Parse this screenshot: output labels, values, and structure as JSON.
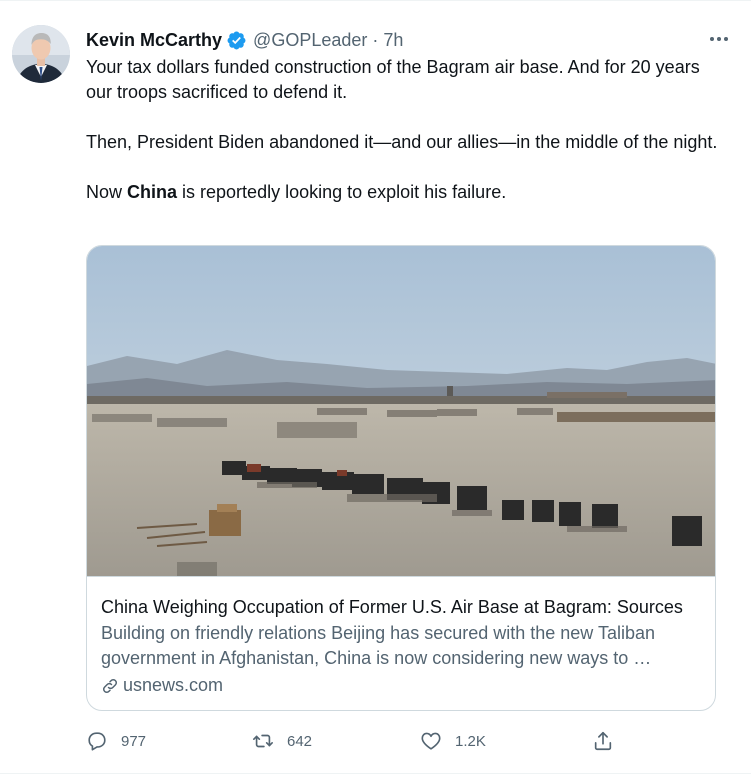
{
  "author": {
    "display_name": "Kevin McCarthy",
    "handle": "@GOPLeader",
    "separator": "·",
    "time": "7h",
    "verified": true
  },
  "tweet": {
    "line1": "Your tax dollars funded construction of the Bagram air base. And for 20 years our troops sacrificed to defend it.",
    "line2": "Then, President Biden abandoned it—and our allies—in the middle of the night.",
    "line3_before": "Now ",
    "line3_bold": "China",
    "line3_after": " is reportedly looking to exploit his failure."
  },
  "card": {
    "title": "China Weighing Occupation of Former U.S. Air Base at Bagram: Sources",
    "description": "Building on friendly relations Beijing has secured with the new Taliban government in Afghanistan, China is now considering new ways to …",
    "domain": "usnews.com"
  },
  "actions": {
    "replies": "977",
    "retweets": "642",
    "likes": "1.2K"
  },
  "colors": {
    "text_primary": "#0f1419",
    "text_secondary": "#536471",
    "verified_blue": "#1d9bf0",
    "border": "#cfd9de"
  },
  "icons": {
    "verified": "verified-badge-icon",
    "more": "more-icon",
    "link": "link-icon",
    "reply": "reply-icon",
    "retweet": "retweet-icon",
    "like": "heart-icon",
    "share": "share-icon"
  }
}
